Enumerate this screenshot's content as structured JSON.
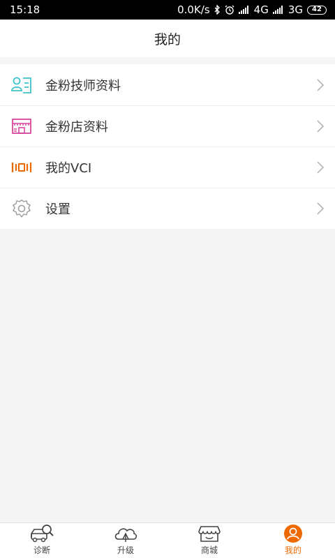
{
  "status": {
    "time": "15:18",
    "speed": "0.0K/s",
    "net1": "4G",
    "net2": "3G",
    "battery": "42"
  },
  "header": {
    "title": "我的"
  },
  "menu": {
    "items": [
      {
        "label": "金粉技师资料",
        "icon": "technician-profile-icon"
      },
      {
        "label": "金粉店资料",
        "icon": "store-icon"
      },
      {
        "label": "我的VCI",
        "icon": "vci-device-icon"
      },
      {
        "label": "设置",
        "icon": "gear-icon"
      }
    ]
  },
  "tabbar": {
    "active_index": 3,
    "accent": "#ee6a00",
    "tabs": [
      {
        "label": "诊断",
        "icon": "car-search-icon"
      },
      {
        "label": "升级",
        "icon": "cloud-upgrade-icon"
      },
      {
        "label": "商城",
        "icon": "shop-icon"
      },
      {
        "label": "我的",
        "icon": "user-icon"
      }
    ]
  },
  "colors": {
    "technician_icon": "#3ec3c8",
    "store_icon": "#d9459d",
    "vci_icon": "#ee6a00",
    "settings_icon": "#9a9a9a",
    "background": "#f5f5f5"
  }
}
